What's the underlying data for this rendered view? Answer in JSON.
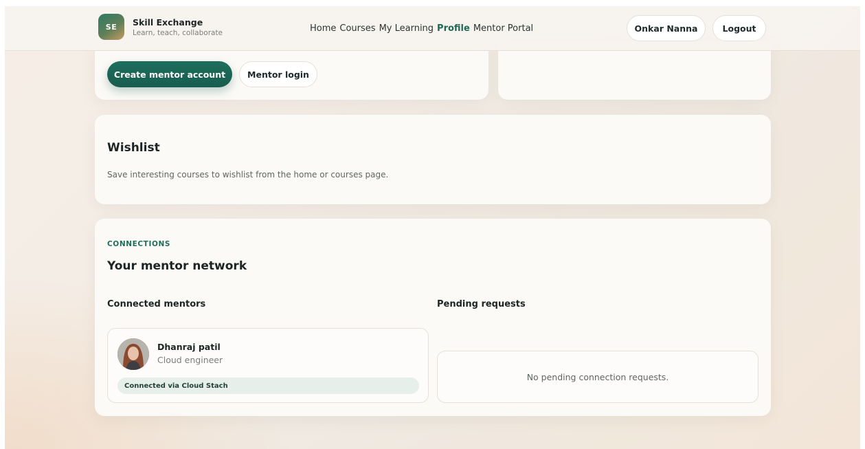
{
  "nav": {
    "logo_initials": "SE",
    "brand_title": "Skill Exchange",
    "brand_subtitle": "Learn, teach, collaborate",
    "links": [
      "Home",
      "Courses",
      "My Learning",
      "Profile",
      "Mentor Portal"
    ],
    "active_link": "Profile",
    "user_label": "Onkar Nanna",
    "logout_label": "Logout"
  },
  "mentor_cta": {
    "create_label": "Create mentor account",
    "login_label": "Mentor login"
  },
  "wishlist": {
    "title": "Wishlist",
    "empty_text": "Save interesting courses to wishlist from the home or courses page."
  },
  "connections": {
    "eyebrow": "CONNECTIONS",
    "title": "Your mentor network",
    "connected_heading": "Connected mentors",
    "pending_heading": "Pending requests",
    "mentors": [
      {
        "name": "Dhanraj patil",
        "role": "Cloud engineer",
        "badge": "Connected via Cloud Stach"
      }
    ],
    "pending_empty_text": "No pending connection requests."
  },
  "colors": {
    "accent": "#1f6e5d",
    "badge_bg": "#e6efea",
    "card_bg": "#fcfaf7"
  }
}
